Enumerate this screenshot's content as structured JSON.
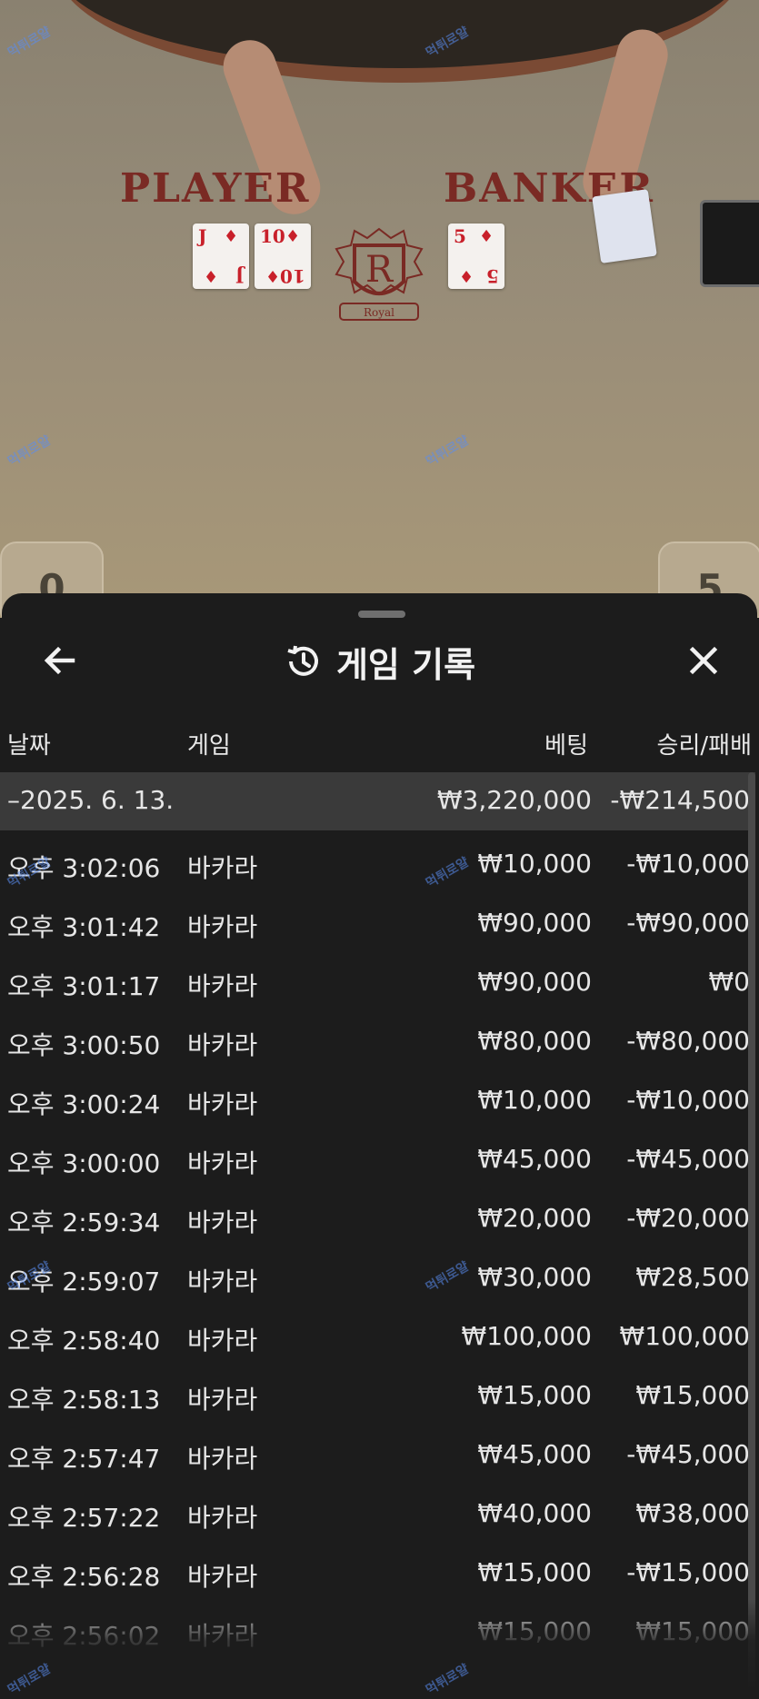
{
  "scene": {
    "player_label": "PLAYER",
    "banker_label": "BANKER",
    "crest_letter": "R",
    "crest_text": "Royal",
    "player_cards": [
      {
        "rank": "J",
        "suit": "♦"
      },
      {
        "rank": "10",
        "suit": "♦"
      }
    ],
    "banker_cards": [
      {
        "rank": "5",
        "suit": "♦"
      }
    ],
    "player_score": "0",
    "banker_score": "5",
    "watermark_text": "먹튀로얄"
  },
  "sheet": {
    "title": "게임 기록",
    "back_icon": "arrow-left-icon",
    "close_icon": "close-icon",
    "history_icon": "history-icon"
  },
  "columns": {
    "date": "날짜",
    "game": "게임",
    "bet": "베팅",
    "result": "승리/패배"
  },
  "summary": {
    "date": "–2025. 6. 13.",
    "bet": "₩3,220,000",
    "result": "-₩214,500"
  },
  "rows": [
    {
      "time": "오후 3:02:06",
      "game": "바카라",
      "bet": "₩10,000",
      "result": "-₩10,000"
    },
    {
      "time": "오후 3:01:42",
      "game": "바카라",
      "bet": "₩90,000",
      "result": "-₩90,000"
    },
    {
      "time": "오후 3:01:17",
      "game": "바카라",
      "bet": "₩90,000",
      "result": "₩0"
    },
    {
      "time": "오후 3:00:50",
      "game": "바카라",
      "bet": "₩80,000",
      "result": "-₩80,000"
    },
    {
      "time": "오후 3:00:24",
      "game": "바카라",
      "bet": "₩10,000",
      "result": "-₩10,000"
    },
    {
      "time": "오후 3:00:00",
      "game": "바카라",
      "bet": "₩45,000",
      "result": "-₩45,000"
    },
    {
      "time": "오후 2:59:34",
      "game": "바카라",
      "bet": "₩20,000",
      "result": "-₩20,000"
    },
    {
      "time": "오후 2:59:07",
      "game": "바카라",
      "bet": "₩30,000",
      "result": "₩28,500"
    },
    {
      "time": "오후 2:58:40",
      "game": "바카라",
      "bet": "₩100,000",
      "result": "₩100,000"
    },
    {
      "time": "오후 2:58:13",
      "game": "바카라",
      "bet": "₩15,000",
      "result": "₩15,000"
    },
    {
      "time": "오후 2:57:47",
      "game": "바카라",
      "bet": "₩45,000",
      "result": "-₩45,000"
    },
    {
      "time": "오후 2:57:22",
      "game": "바카라",
      "bet": "₩40,000",
      "result": "₩38,000"
    },
    {
      "time": "오후 2:56:28",
      "game": "바카라",
      "bet": "₩15,000",
      "result": "-₩15,000"
    },
    {
      "time": "오후 2:56:02",
      "game": "바카라",
      "bet": "₩15,000",
      "result": "₩15,000"
    }
  ],
  "colors": {
    "sheet_bg": "#1c1c1c",
    "summary_bg": "#3a3a3a",
    "text": "#e6e6e6",
    "table_felt": "#9c8f78",
    "table_print": "#7a2a24",
    "card_red": "#c8202a"
  }
}
